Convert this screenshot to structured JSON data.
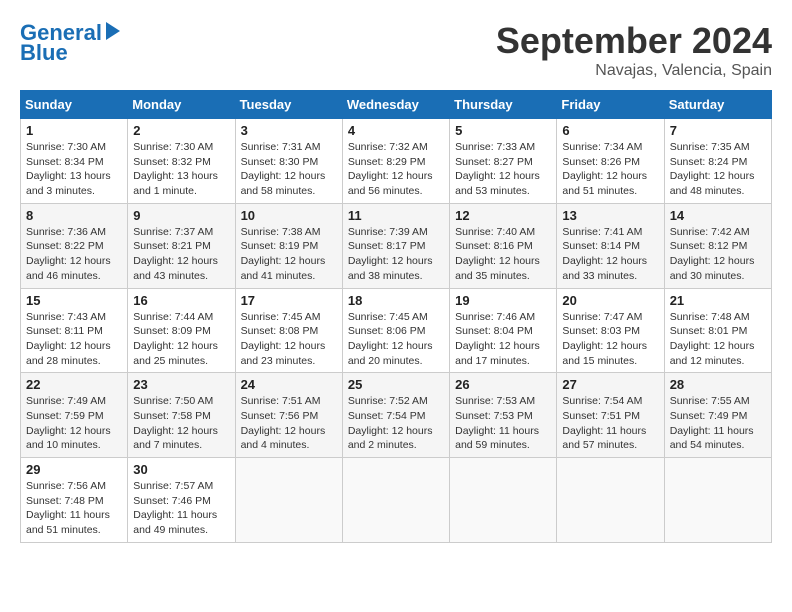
{
  "header": {
    "logo_line1": "General",
    "logo_line2": "Blue",
    "month_title": "September 2024",
    "location": "Navajas, Valencia, Spain"
  },
  "weekdays": [
    "Sunday",
    "Monday",
    "Tuesday",
    "Wednesday",
    "Thursday",
    "Friday",
    "Saturday"
  ],
  "weeks": [
    [
      {
        "day": "1",
        "info": "Sunrise: 7:30 AM\nSunset: 8:34 PM\nDaylight: 13 hours\nand 3 minutes."
      },
      {
        "day": "2",
        "info": "Sunrise: 7:30 AM\nSunset: 8:32 PM\nDaylight: 13 hours\nand 1 minute."
      },
      {
        "day": "3",
        "info": "Sunrise: 7:31 AM\nSunset: 8:30 PM\nDaylight: 12 hours\nand 58 minutes."
      },
      {
        "day": "4",
        "info": "Sunrise: 7:32 AM\nSunset: 8:29 PM\nDaylight: 12 hours\nand 56 minutes."
      },
      {
        "day": "5",
        "info": "Sunrise: 7:33 AM\nSunset: 8:27 PM\nDaylight: 12 hours\nand 53 minutes."
      },
      {
        "day": "6",
        "info": "Sunrise: 7:34 AM\nSunset: 8:26 PM\nDaylight: 12 hours\nand 51 minutes."
      },
      {
        "day": "7",
        "info": "Sunrise: 7:35 AM\nSunset: 8:24 PM\nDaylight: 12 hours\nand 48 minutes."
      }
    ],
    [
      {
        "day": "8",
        "info": "Sunrise: 7:36 AM\nSunset: 8:22 PM\nDaylight: 12 hours\nand 46 minutes."
      },
      {
        "day": "9",
        "info": "Sunrise: 7:37 AM\nSunset: 8:21 PM\nDaylight: 12 hours\nand 43 minutes."
      },
      {
        "day": "10",
        "info": "Sunrise: 7:38 AM\nSunset: 8:19 PM\nDaylight: 12 hours\nand 41 minutes."
      },
      {
        "day": "11",
        "info": "Sunrise: 7:39 AM\nSunset: 8:17 PM\nDaylight: 12 hours\nand 38 minutes."
      },
      {
        "day": "12",
        "info": "Sunrise: 7:40 AM\nSunset: 8:16 PM\nDaylight: 12 hours\nand 35 minutes."
      },
      {
        "day": "13",
        "info": "Sunrise: 7:41 AM\nSunset: 8:14 PM\nDaylight: 12 hours\nand 33 minutes."
      },
      {
        "day": "14",
        "info": "Sunrise: 7:42 AM\nSunset: 8:12 PM\nDaylight: 12 hours\nand 30 minutes."
      }
    ],
    [
      {
        "day": "15",
        "info": "Sunrise: 7:43 AM\nSunset: 8:11 PM\nDaylight: 12 hours\nand 28 minutes."
      },
      {
        "day": "16",
        "info": "Sunrise: 7:44 AM\nSunset: 8:09 PM\nDaylight: 12 hours\nand 25 minutes."
      },
      {
        "day": "17",
        "info": "Sunrise: 7:45 AM\nSunset: 8:08 PM\nDaylight: 12 hours\nand 23 minutes."
      },
      {
        "day": "18",
        "info": "Sunrise: 7:45 AM\nSunset: 8:06 PM\nDaylight: 12 hours\nand 20 minutes."
      },
      {
        "day": "19",
        "info": "Sunrise: 7:46 AM\nSunset: 8:04 PM\nDaylight: 12 hours\nand 17 minutes."
      },
      {
        "day": "20",
        "info": "Sunrise: 7:47 AM\nSunset: 8:03 PM\nDaylight: 12 hours\nand 15 minutes."
      },
      {
        "day": "21",
        "info": "Sunrise: 7:48 AM\nSunset: 8:01 PM\nDaylight: 12 hours\nand 12 minutes."
      }
    ],
    [
      {
        "day": "22",
        "info": "Sunrise: 7:49 AM\nSunset: 7:59 PM\nDaylight: 12 hours\nand 10 minutes."
      },
      {
        "day": "23",
        "info": "Sunrise: 7:50 AM\nSunset: 7:58 PM\nDaylight: 12 hours\nand 7 minutes."
      },
      {
        "day": "24",
        "info": "Sunrise: 7:51 AM\nSunset: 7:56 PM\nDaylight: 12 hours\nand 4 minutes."
      },
      {
        "day": "25",
        "info": "Sunrise: 7:52 AM\nSunset: 7:54 PM\nDaylight: 12 hours\nand 2 minutes."
      },
      {
        "day": "26",
        "info": "Sunrise: 7:53 AM\nSunset: 7:53 PM\nDaylight: 11 hours\nand 59 minutes."
      },
      {
        "day": "27",
        "info": "Sunrise: 7:54 AM\nSunset: 7:51 PM\nDaylight: 11 hours\nand 57 minutes."
      },
      {
        "day": "28",
        "info": "Sunrise: 7:55 AM\nSunset: 7:49 PM\nDaylight: 11 hours\nand 54 minutes."
      }
    ],
    [
      {
        "day": "29",
        "info": "Sunrise: 7:56 AM\nSunset: 7:48 PM\nDaylight: 11 hours\nand 51 minutes."
      },
      {
        "day": "30",
        "info": "Sunrise: 7:57 AM\nSunset: 7:46 PM\nDaylight: 11 hours\nand 49 minutes."
      },
      null,
      null,
      null,
      null,
      null
    ]
  ]
}
